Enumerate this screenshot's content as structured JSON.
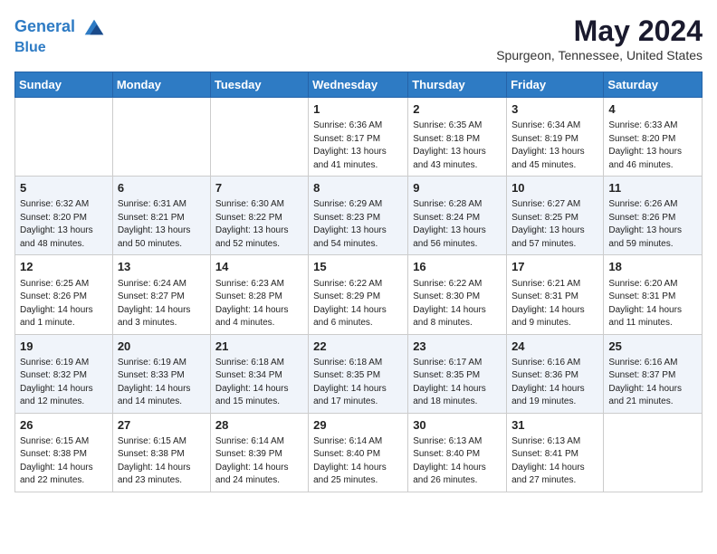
{
  "header": {
    "logo_line1": "General",
    "logo_line2": "Blue",
    "month_title": "May 2024",
    "location": "Spurgeon, Tennessee, United States"
  },
  "weekdays": [
    "Sunday",
    "Monday",
    "Tuesday",
    "Wednesday",
    "Thursday",
    "Friday",
    "Saturday"
  ],
  "weeks": [
    [
      {
        "day": "",
        "info": ""
      },
      {
        "day": "",
        "info": ""
      },
      {
        "day": "",
        "info": ""
      },
      {
        "day": "1",
        "info": "Sunrise: 6:36 AM\nSunset: 8:17 PM\nDaylight: 13 hours\nand 41 minutes."
      },
      {
        "day": "2",
        "info": "Sunrise: 6:35 AM\nSunset: 8:18 PM\nDaylight: 13 hours\nand 43 minutes."
      },
      {
        "day": "3",
        "info": "Sunrise: 6:34 AM\nSunset: 8:19 PM\nDaylight: 13 hours\nand 45 minutes."
      },
      {
        "day": "4",
        "info": "Sunrise: 6:33 AM\nSunset: 8:20 PM\nDaylight: 13 hours\nand 46 minutes."
      }
    ],
    [
      {
        "day": "5",
        "info": "Sunrise: 6:32 AM\nSunset: 8:20 PM\nDaylight: 13 hours\nand 48 minutes."
      },
      {
        "day": "6",
        "info": "Sunrise: 6:31 AM\nSunset: 8:21 PM\nDaylight: 13 hours\nand 50 minutes."
      },
      {
        "day": "7",
        "info": "Sunrise: 6:30 AM\nSunset: 8:22 PM\nDaylight: 13 hours\nand 52 minutes."
      },
      {
        "day": "8",
        "info": "Sunrise: 6:29 AM\nSunset: 8:23 PM\nDaylight: 13 hours\nand 54 minutes."
      },
      {
        "day": "9",
        "info": "Sunrise: 6:28 AM\nSunset: 8:24 PM\nDaylight: 13 hours\nand 56 minutes."
      },
      {
        "day": "10",
        "info": "Sunrise: 6:27 AM\nSunset: 8:25 PM\nDaylight: 13 hours\nand 57 minutes."
      },
      {
        "day": "11",
        "info": "Sunrise: 6:26 AM\nSunset: 8:26 PM\nDaylight: 13 hours\nand 59 minutes."
      }
    ],
    [
      {
        "day": "12",
        "info": "Sunrise: 6:25 AM\nSunset: 8:26 PM\nDaylight: 14 hours\nand 1 minute."
      },
      {
        "day": "13",
        "info": "Sunrise: 6:24 AM\nSunset: 8:27 PM\nDaylight: 14 hours\nand 3 minutes."
      },
      {
        "day": "14",
        "info": "Sunrise: 6:23 AM\nSunset: 8:28 PM\nDaylight: 14 hours\nand 4 minutes."
      },
      {
        "day": "15",
        "info": "Sunrise: 6:22 AM\nSunset: 8:29 PM\nDaylight: 14 hours\nand 6 minutes."
      },
      {
        "day": "16",
        "info": "Sunrise: 6:22 AM\nSunset: 8:30 PM\nDaylight: 14 hours\nand 8 minutes."
      },
      {
        "day": "17",
        "info": "Sunrise: 6:21 AM\nSunset: 8:31 PM\nDaylight: 14 hours\nand 9 minutes."
      },
      {
        "day": "18",
        "info": "Sunrise: 6:20 AM\nSunset: 8:31 PM\nDaylight: 14 hours\nand 11 minutes."
      }
    ],
    [
      {
        "day": "19",
        "info": "Sunrise: 6:19 AM\nSunset: 8:32 PM\nDaylight: 14 hours\nand 12 minutes."
      },
      {
        "day": "20",
        "info": "Sunrise: 6:19 AM\nSunset: 8:33 PM\nDaylight: 14 hours\nand 14 minutes."
      },
      {
        "day": "21",
        "info": "Sunrise: 6:18 AM\nSunset: 8:34 PM\nDaylight: 14 hours\nand 15 minutes."
      },
      {
        "day": "22",
        "info": "Sunrise: 6:18 AM\nSunset: 8:35 PM\nDaylight: 14 hours\nand 17 minutes."
      },
      {
        "day": "23",
        "info": "Sunrise: 6:17 AM\nSunset: 8:35 PM\nDaylight: 14 hours\nand 18 minutes."
      },
      {
        "day": "24",
        "info": "Sunrise: 6:16 AM\nSunset: 8:36 PM\nDaylight: 14 hours\nand 19 minutes."
      },
      {
        "day": "25",
        "info": "Sunrise: 6:16 AM\nSunset: 8:37 PM\nDaylight: 14 hours\nand 21 minutes."
      }
    ],
    [
      {
        "day": "26",
        "info": "Sunrise: 6:15 AM\nSunset: 8:38 PM\nDaylight: 14 hours\nand 22 minutes."
      },
      {
        "day": "27",
        "info": "Sunrise: 6:15 AM\nSunset: 8:38 PM\nDaylight: 14 hours\nand 23 minutes."
      },
      {
        "day": "28",
        "info": "Sunrise: 6:14 AM\nSunset: 8:39 PM\nDaylight: 14 hours\nand 24 minutes."
      },
      {
        "day": "29",
        "info": "Sunrise: 6:14 AM\nSunset: 8:40 PM\nDaylight: 14 hours\nand 25 minutes."
      },
      {
        "day": "30",
        "info": "Sunrise: 6:13 AM\nSunset: 8:40 PM\nDaylight: 14 hours\nand 26 minutes."
      },
      {
        "day": "31",
        "info": "Sunrise: 6:13 AM\nSunset: 8:41 PM\nDaylight: 14 hours\nand 27 minutes."
      },
      {
        "day": "",
        "info": ""
      }
    ]
  ]
}
